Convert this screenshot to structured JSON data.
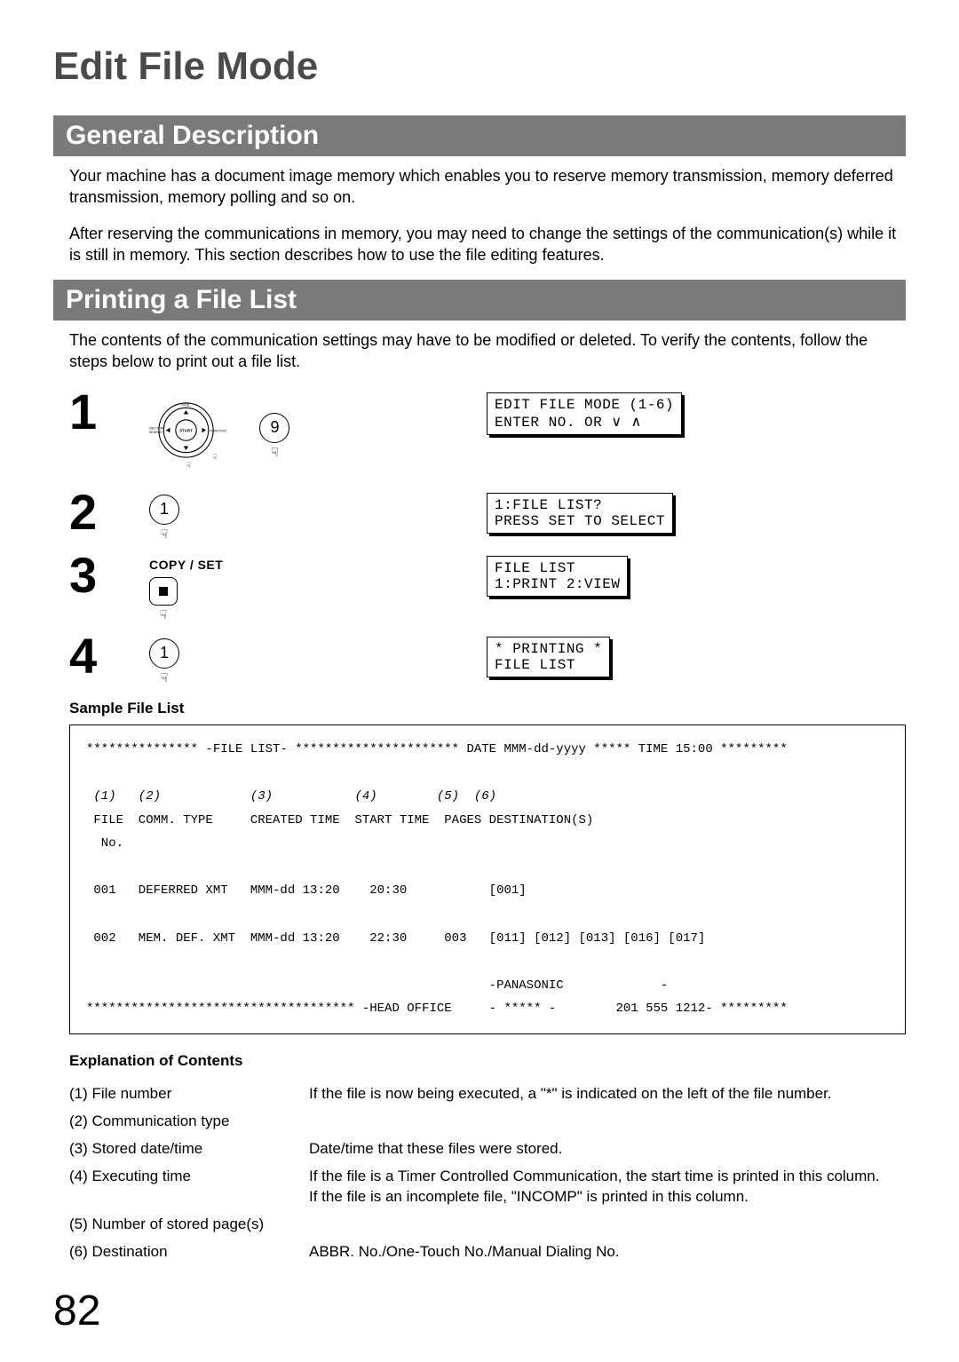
{
  "page_title": "Edit File Mode",
  "section1": {
    "heading": "General Description",
    "p1": "Your machine has a document image memory which enables you to reserve memory transmission, memory deferred transmission, memory polling and so on.",
    "p2": "After reserving the communications in memory, you may need to change the settings of the communication(s) while it is still in memory.  This section describes how to use the file editing features."
  },
  "section2": {
    "heading": "Printing a File List",
    "p1": "The contents of the communication settings may have to be modified or deleted.  To verify the contents, follow the steps below to print out a file list."
  },
  "steps": [
    {
      "num": "1",
      "key_label": "9",
      "dial_labels": {
        "top": "+VOL.",
        "left": "DIRECTORY\nSEARCH",
        "center": "START",
        "right": "FUNCTION"
      },
      "lcd": "EDIT FILE MODE (1-6)\nENTER NO. OR ∨ ∧"
    },
    {
      "num": "2",
      "key_label": "1",
      "lcd": "1:FILE LIST?\nPRESS SET TO SELECT"
    },
    {
      "num": "3",
      "copy_set": "COPY / SET",
      "stop_icon": true,
      "lcd": "FILE LIST\n1:PRINT 2:VIEW"
    },
    {
      "num": "4",
      "key_label": "1",
      "lcd": "* PRINTING *\nFILE LIST"
    }
  ],
  "sample": {
    "label": "Sample File List",
    "header_line": "*************** -FILE LIST- ********************** DATE MMM-dd-yyyy ***** TIME 15:00 *********",
    "col_nums": " (1)   (2)            (3)           (4)        (5)  (6)",
    "col_hdr": " FILE  COMM. TYPE     CREATED TIME  START TIME  PAGES DESTINATION(S)\n  No.",
    "row1": " 001   DEFERRED XMT   MMM-dd 13:20    20:30           [001]",
    "row2": " 002   MEM. DEF. XMT  MMM-dd 13:20    22:30     003   [011] [012] [013] [016] [017]",
    "brand": "                                                      -PANASONIC             -",
    "footer": "************************************ -HEAD OFFICE     - ***** -        201 555 1212- *********"
  },
  "explan": {
    "heading": "Explanation of Contents",
    "rows": [
      {
        "l": "(1) File number",
        "r": "If the file is now being executed, a \"*\" is indicated on the left of the file number."
      },
      {
        "l": "(2) Communication type",
        "r": ""
      },
      {
        "l": "(3) Stored date/time",
        "r": "Date/time that these files were stored."
      },
      {
        "l": "(4) Executing time",
        "r": "If the file is a Timer Controlled Communication, the start time is printed in this column.\nIf the file is an incomplete file, \"INCOMP\" is printed in this column."
      },
      {
        "l": "(5) Number of stored page(s)",
        "r": ""
      },
      {
        "l": "(6) Destination",
        "r": "ABBR. No./One-Touch No./Manual Dialing No."
      }
    ]
  },
  "page_number": "82"
}
